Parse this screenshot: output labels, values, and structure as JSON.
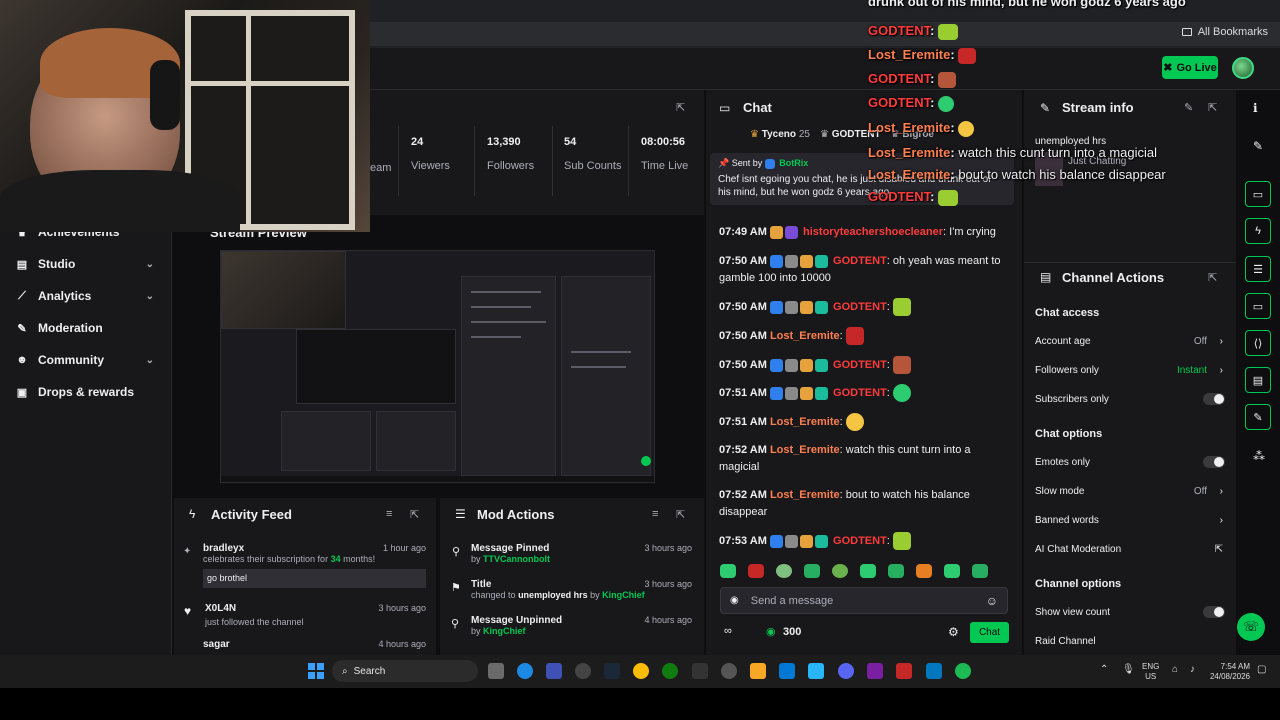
{
  "browser": {
    "bookmarks_label": "All Bookmarks"
  },
  "topbar": {
    "go_live": "Go Live"
  },
  "sidebar": {
    "items": [
      {
        "label": "Achievements"
      },
      {
        "label": "Studio"
      },
      {
        "label": "Analytics"
      },
      {
        "label": "Moderation"
      },
      {
        "label": "Community"
      },
      {
        "label": "Drops & rewards"
      }
    ]
  },
  "stats": [
    {
      "value": "",
      "label": "eam"
    },
    {
      "value": "24",
      "label": "Viewers"
    },
    {
      "value": "13,390",
      "label": "Followers"
    },
    {
      "value": "54",
      "label": "Sub Counts"
    },
    {
      "value": "08:00:56",
      "label": "Time Live"
    }
  ],
  "preview": {
    "title": "Stream Preview"
  },
  "activity": {
    "title": "Activity Feed",
    "items": [
      {
        "name": "bradleyx",
        "text": "celebrates their subscription for",
        "months": "34",
        "suffix": "months!",
        "message": "go brothel",
        "time": "1 hour ago"
      },
      {
        "name": "X0L4N",
        "text": "just followed the channel",
        "time": "3 hours ago"
      },
      {
        "name": "sagar",
        "text": "",
        "time": "4 hours ago"
      }
    ]
  },
  "mod": {
    "title": "Mod Actions",
    "items": [
      {
        "title": "Message Pinned",
        "by": "by",
        "user": "TTVCannonbolt",
        "time": "3 hours ago"
      },
      {
        "title": "Title",
        "pre": "changed to",
        "detail": "unemployed hrs",
        "by": "by",
        "user": "KingChief",
        "time": "3 hours ago"
      },
      {
        "title": "Message Unpinned",
        "by": "by",
        "user": "KingChief",
        "time": "4 hours ago"
      }
    ]
  },
  "chat": {
    "title": "Chat",
    "top_gifters": [
      {
        "name": "Tyceno",
        "count": "25"
      },
      {
        "name": "GODTENT",
        "count": ""
      },
      {
        "name": "Bigroe",
        "count": ""
      }
    ],
    "pinned": {
      "sent_by": "Sent by",
      "sender": "BotRix",
      "text": "Chef isnt egoing you chat, he is just disabled and drunk out of his mind, but he won godz 6 years ago"
    },
    "messages": [
      {
        "time": "07:49 AM",
        "user": "historyteachershoecleaner",
        "text": "I'm crying"
      },
      {
        "time": "07:50 AM",
        "user": "GODTENT",
        "text": "oh yeah was meant to gamble 100 into 10000"
      },
      {
        "time": "07:50 AM",
        "user": "GODTENT",
        "text": ""
      },
      {
        "time": "07:50 AM",
        "user": "Lost_Eremite",
        "text": ""
      },
      {
        "time": "07:50 AM",
        "user": "GODTENT",
        "text": ""
      },
      {
        "time": "07:51 AM",
        "user": "GODTENT",
        "text": ""
      },
      {
        "time": "07:51 AM",
        "user": "Lost_Eremite",
        "text": ""
      },
      {
        "time": "07:52 AM",
        "user": "Lost_Eremite",
        "text": "watch this cunt turn into a magicial"
      },
      {
        "time": "07:52 AM",
        "user": "Lost_Eremite",
        "text": "bout to watch his balance disappear"
      },
      {
        "time": "07:53 AM",
        "user": "GODTENT",
        "text": ""
      }
    ],
    "input_placeholder": "Send a message",
    "points": "300",
    "send_label": "Chat"
  },
  "stream_info": {
    "title": "Stream info",
    "stream_title": "unemployed hrs",
    "category": "Just Chatting"
  },
  "channel_actions": {
    "title": "Channel Actions",
    "chat_access": "Chat access",
    "account_age": {
      "label": "Account age",
      "value": "Off"
    },
    "followers_only": {
      "label": "Followers only",
      "value": "Instant"
    },
    "subscribers_only": {
      "label": "Subscribers only"
    },
    "chat_options": "Chat options",
    "emotes_only": {
      "label": "Emotes only"
    },
    "slow_mode": {
      "label": "Slow mode",
      "value": "Off"
    },
    "banned_words": {
      "label": "Banned words"
    },
    "ai_moderation": {
      "label": "AI Chat Moderation"
    },
    "channel_options": "Channel options",
    "show_view_count": {
      "label": "Show view count"
    },
    "raid_channel": {
      "label": "Raid Channel"
    }
  },
  "overlay": {
    "lines": [
      {
        "user": "",
        "text": "drunk out of his mind, but he won godz 6 years ago"
      },
      {
        "user": "GODTENT",
        "text": ""
      },
      {
        "user": "Lost_Eremite",
        "text": ""
      },
      {
        "user": "GODTENT",
        "text": ""
      },
      {
        "user": "GODTENT",
        "text": ""
      },
      {
        "user": "Lost_Eremite",
        "text": ""
      },
      {
        "user": "Lost_Eremite",
        "text": "watch this cunt turn into a magicial"
      },
      {
        "user": "Lost_Eremite",
        "text": "bout to watch his balance disappear"
      },
      {
        "user": "GODTENT",
        "text": ""
      }
    ]
  },
  "taskbar": {
    "search": "Search",
    "lang": "ENG",
    "region": "US",
    "time": "7:54 AM",
    "date": "24/08/2026"
  },
  "colors": {
    "accent": "#00c853",
    "bg": "#0e0e10",
    "panel": "#18181b"
  }
}
